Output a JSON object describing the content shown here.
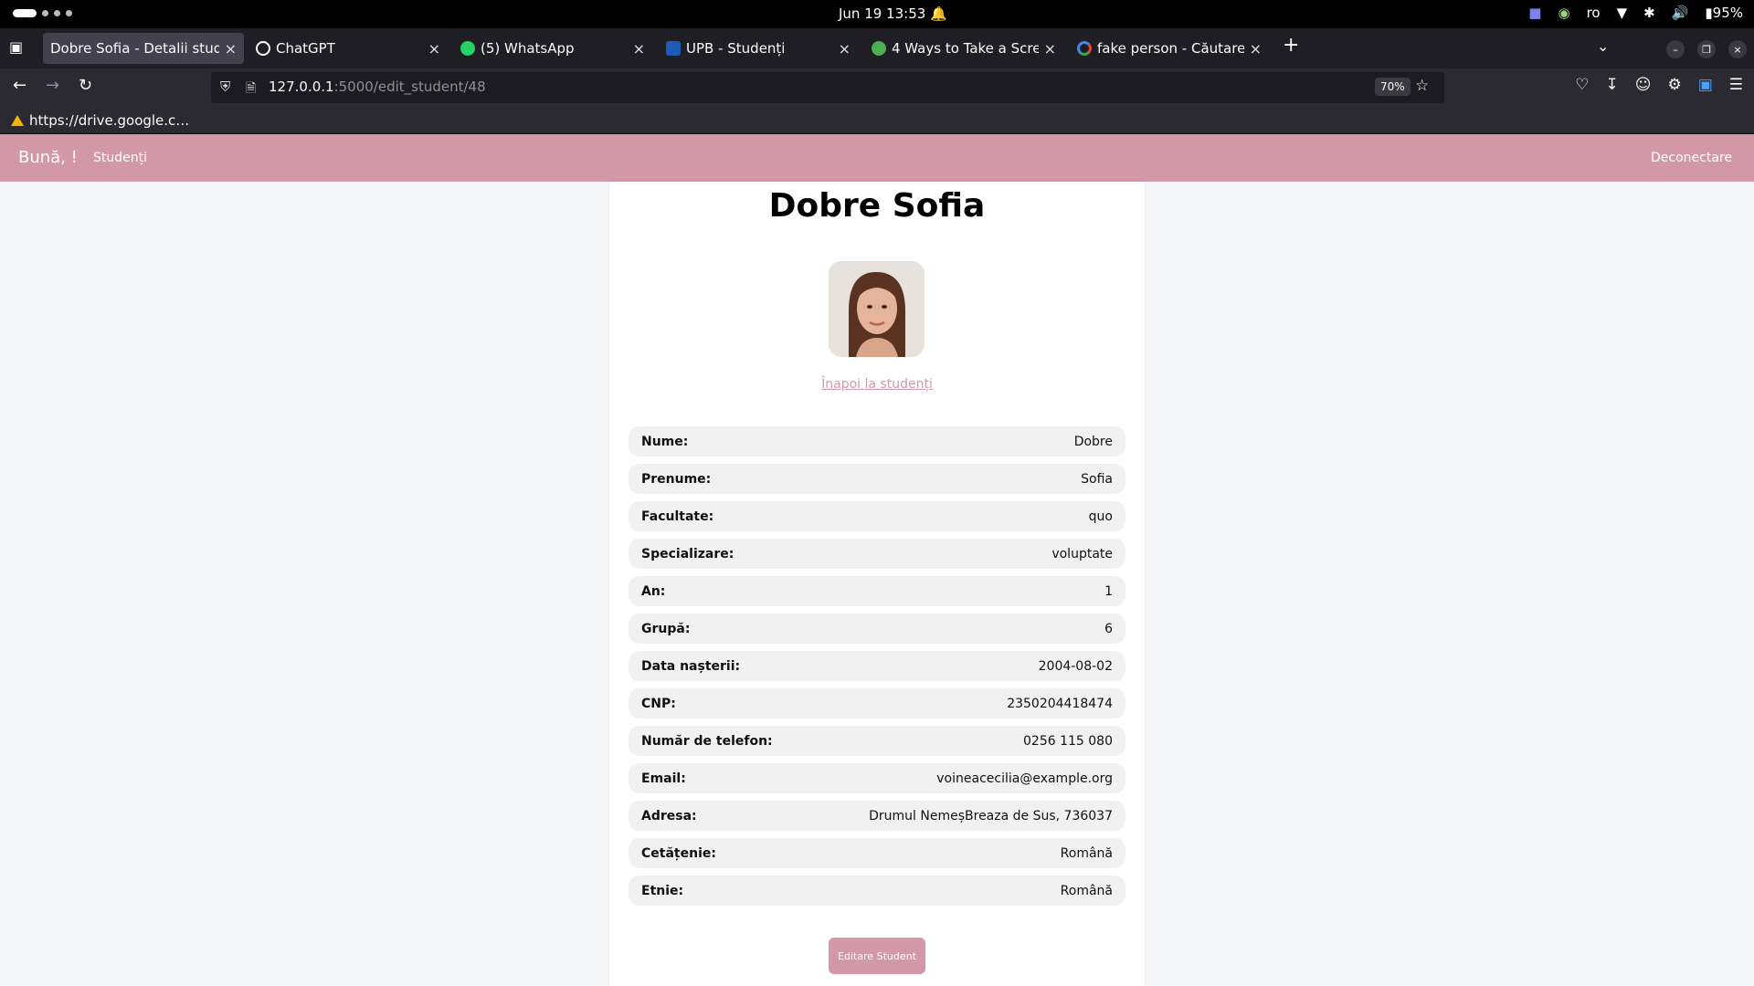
{
  "os": {
    "clock": "Jun 19  13:53",
    "lang": "ro",
    "battery": "95%"
  },
  "tabs": [
    {
      "title": "Dobre Sofia - Detalii student",
      "active": true,
      "favicon_color": "#42414d"
    },
    {
      "title": "ChatGPT",
      "active": false,
      "favicon_color": "#ffffff"
    },
    {
      "title": "(5) WhatsApp",
      "active": false,
      "favicon_color": "#25d366"
    },
    {
      "title": "UPB - Studenți",
      "active": false,
      "favicon_color": "#1e5bb8"
    },
    {
      "title": "4 Ways to Take a Screensh",
      "active": false,
      "favicon_color": "#4caf50"
    },
    {
      "title": "fake person - Căutare Goo",
      "active": false,
      "favicon_color": "#4285f4"
    }
  ],
  "browser": {
    "url_host": "127.0.0.1",
    "url_rest": ":5000/edit_student/48",
    "zoom": "70%",
    "bookmark": "https://drive.google.c…"
  },
  "site": {
    "brand": "Bună, !",
    "nav_students": "Studenți",
    "logout": "Deconectare"
  },
  "student": {
    "full_name": "Dobre Sofia",
    "back_link": "Înapoi la studenți",
    "fields": [
      {
        "label": "Nume:",
        "value": "Dobre"
      },
      {
        "label": "Prenume:",
        "value": "Sofia"
      },
      {
        "label": "Facultate:",
        "value": "quo"
      },
      {
        "label": "Specializare:",
        "value": "voluptate"
      },
      {
        "label": "An:",
        "value": "1"
      },
      {
        "label": "Grupă:",
        "value": "6"
      },
      {
        "label": "Data nașterii:",
        "value": "2004-08-02"
      },
      {
        "label": "CNP:",
        "value": "2350204418474"
      },
      {
        "label": "Număr de telefon:",
        "value": "0256 115 080"
      },
      {
        "label": "Email:",
        "value": "voineacecilia@example.org"
      },
      {
        "label": "Adresa:",
        "value": "Drumul NemeșBreaza de Sus, 736037"
      },
      {
        "label": "Cetățenie:",
        "value": "Română"
      },
      {
        "label": "Etnie:",
        "value": "Română"
      }
    ],
    "edit_button": "Editare Student"
  },
  "colors": {
    "accent": "#d398a8",
    "row_bg": "#f1f1f1"
  }
}
